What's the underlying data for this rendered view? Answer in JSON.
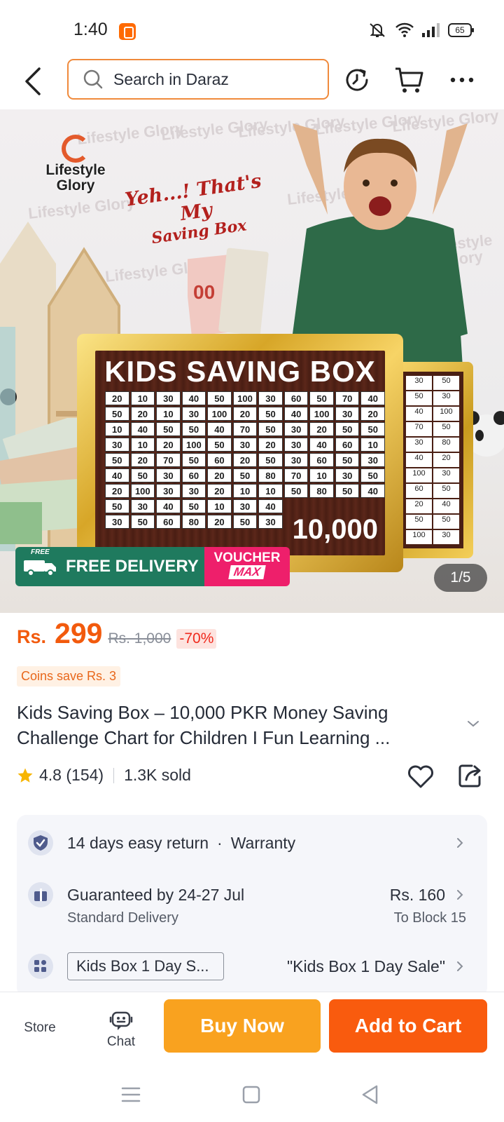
{
  "status_bar": {
    "time": "1:40",
    "battery_level": "65"
  },
  "header": {
    "search_placeholder": "Search in Daraz"
  },
  "hero": {
    "brand_line1": "Lifestyle",
    "brand_line2": "Glory",
    "tagline_line1": "Yeh...! That's My",
    "tagline_line2": "Saving Box",
    "box_title": "KIDS SAVING BOX",
    "box_total": "10,000",
    "grid_numbers": [
      [
        "20",
        "10",
        "30",
        "40",
        "50",
        "100",
        "30",
        "60",
        "50",
        "70",
        "40"
      ],
      [
        "50",
        "20",
        "10",
        "30",
        "100",
        "20",
        "50",
        "40",
        "100",
        "30",
        "20"
      ],
      [
        "10",
        "40",
        "50",
        "50",
        "40",
        "70",
        "50",
        "30",
        "20",
        "50",
        "50"
      ],
      [
        "30",
        "10",
        "20",
        "100",
        "50",
        "30",
        "20",
        "30",
        "40",
        "60",
        "10"
      ],
      [
        "50",
        "20",
        "70",
        "50",
        "60",
        "20",
        "50",
        "30",
        "60",
        "50",
        "30"
      ],
      [
        "40",
        "50",
        "30",
        "60",
        "20",
        "50",
        "80",
        "70",
        "10",
        "30",
        "50"
      ],
      [
        "20",
        "100",
        "30",
        "30",
        "20",
        "10",
        "10",
        "50",
        "80",
        "50",
        "40"
      ],
      [
        "50",
        "30",
        "40",
        "50",
        "10",
        "30",
        "40"
      ],
      [
        "30",
        "50",
        "60",
        "80",
        "20",
        "50",
        "30"
      ]
    ],
    "back_box_numbers": [
      "30",
      "50",
      "50",
      "30",
      "40",
      "100",
      "70",
      "50",
      "30",
      "80",
      "40",
      "20",
      "100",
      "30",
      "60",
      "50",
      "20",
      "40",
      "50",
      "50",
      "100",
      "30"
    ],
    "free_tag": "FREE",
    "free_delivery_label": "FREE DELIVERY",
    "voucher_label": "VOUCHER",
    "voucher_max": "MAX",
    "pager": "1/5",
    "watermark": "Lifestyle Glory"
  },
  "price": {
    "currency": "Rs.",
    "value": "299",
    "original": "Rs. 1,000",
    "discount": "-70%",
    "coins": "Coins save Rs. 3"
  },
  "product": {
    "title": "Kids Saving Box – 10,000 PKR Money Saving Challenge Chart for Children I Fun Learning ...",
    "rating": "4.8 (154)",
    "sold": "1.3K sold"
  },
  "info": {
    "returns": "14 days easy return",
    "dot": "·",
    "warranty": "Warranty",
    "delivery_title": "Guaranteed by 24-27 Jul",
    "delivery_type": "Standard Delivery",
    "delivery_price": "Rs. 160",
    "delivery_destination": "To Block 15",
    "promo_chip": "Kids Box 1 Day S...",
    "promo_name": "\"Kids Box 1 Day Sale\""
  },
  "actions": {
    "store": "Store",
    "chat": "Chat",
    "buy_now": "Buy Now",
    "add_to_cart": "Add to Cart"
  },
  "colors": {
    "brand_orange": "#f95b0e",
    "buy_now": "#f9a21f",
    "price": "#f25a0d",
    "search_border": "#f08a3c"
  }
}
